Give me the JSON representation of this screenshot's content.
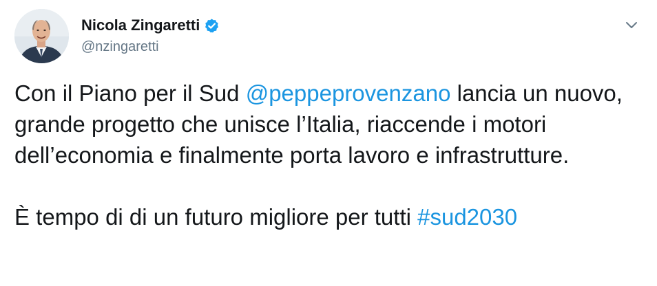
{
  "author": {
    "display_name": "Nicola Zingaretti",
    "handle": "@nzingaretti",
    "verified": true,
    "avatar_icon": "profile-photo",
    "verified_icon": "verified-badge-icon",
    "verified_color": "#1da1f2"
  },
  "menu": {
    "icon": "chevron-down-icon"
  },
  "tweet": {
    "paragraph1": {
      "before_mention": "Con il Piano per il Sud ",
      "mention": "@peppeprovenzano",
      "after_mention": " lancia un nuovo, grande progetto che unisce l’Italia, riaccende i motori dell’economia e finalmente porta lavoro e infrastrutture."
    },
    "paragraph2": {
      "before_hashtag": "È tempo di di un futuro migliore per tutti ",
      "hashtag": "#sud2030"
    }
  },
  "colors": {
    "text": "#14171a",
    "secondary_text": "#657786",
    "link": "#1b95e0"
  }
}
